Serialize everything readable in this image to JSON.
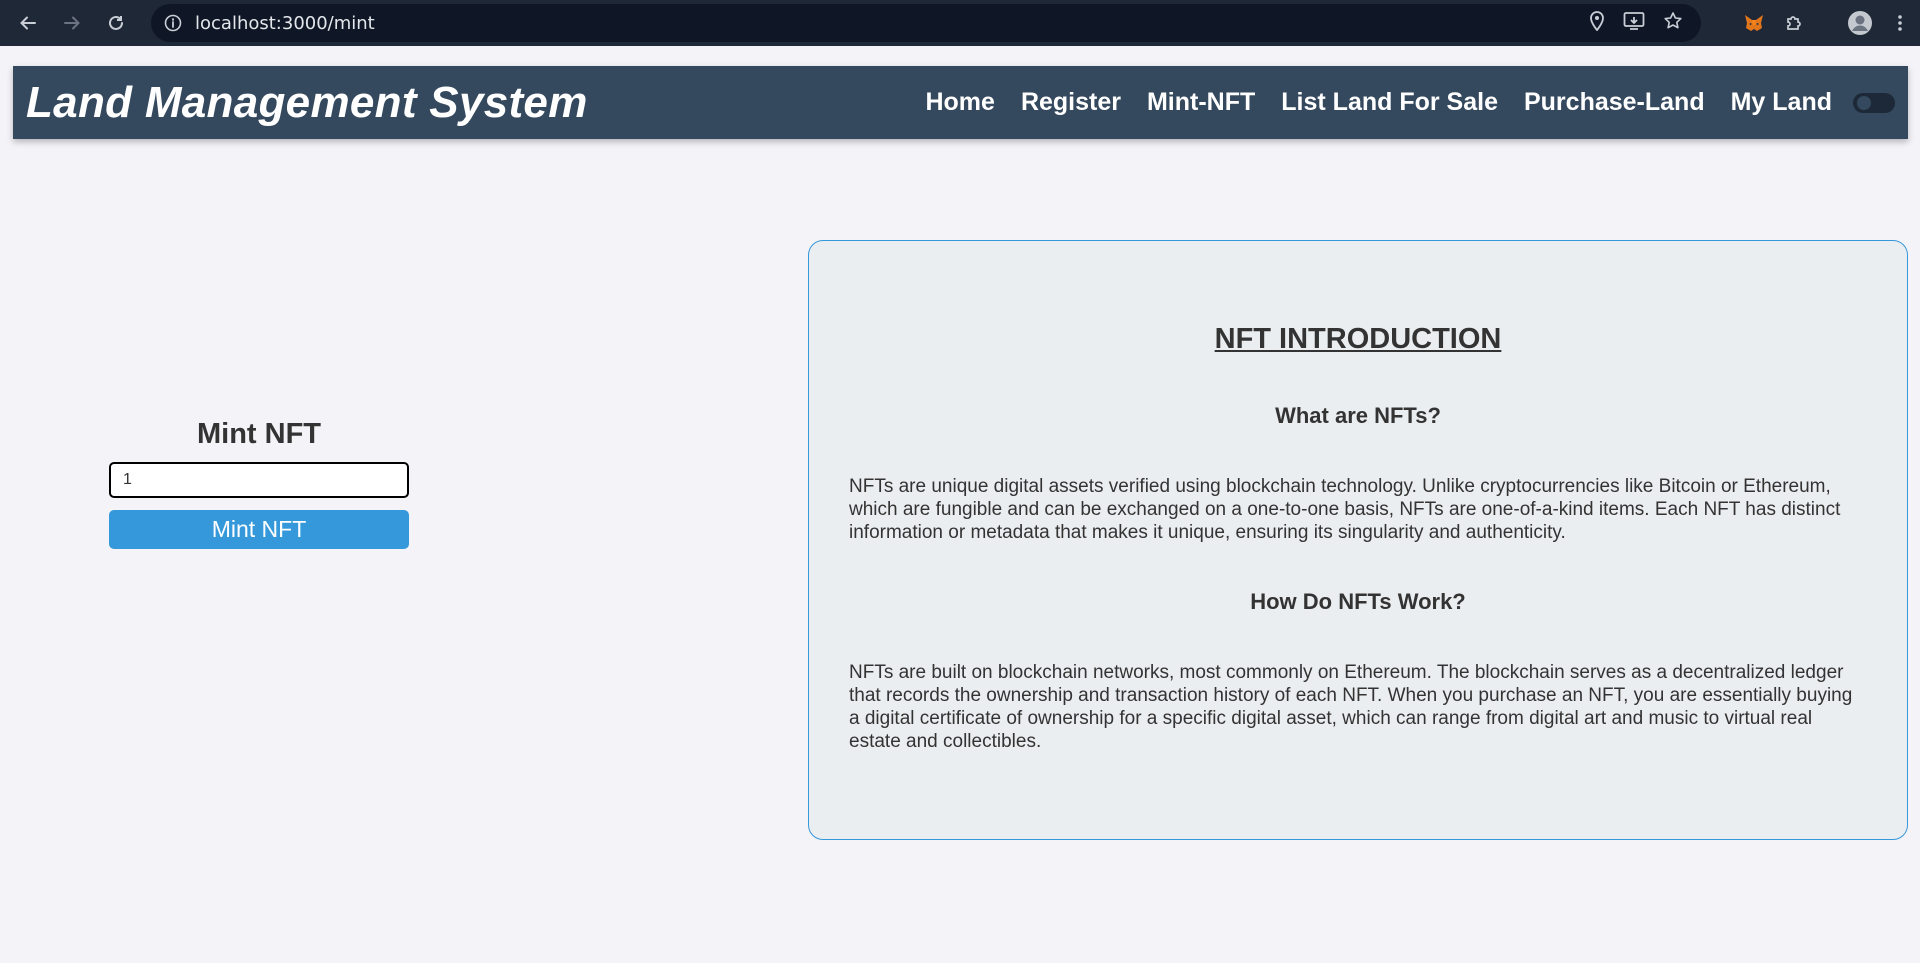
{
  "browser": {
    "url": "localhost:3000/mint"
  },
  "header": {
    "brand": "Land Management System",
    "menu": [
      "Home",
      "Register",
      "Mint-NFT",
      "List Land For Sale",
      "Purchase-Land",
      "My Land"
    ]
  },
  "mint": {
    "title": "Mint NFT",
    "input_value": "1",
    "button_label": "Mint NFT"
  },
  "intro": {
    "heading": "NFT INTRODUCTION",
    "q1": "What are NFTs?",
    "p1": "NFTs are unique digital assets verified using blockchain technology. Unlike cryptocurrencies like Bitcoin or Ethereum, which are fungible and can be exchanged on a one-to-one basis, NFTs are one-of-a-kind items. Each NFT has distinct information or metadata that makes it unique, ensuring its singularity and authenticity.",
    "q2": "How Do NFTs Work?",
    "p2": "NFTs are built on blockchain networks, most commonly on Ethereum. The blockchain serves as a decentralized ledger that records the ownership and transaction history of each NFT. When you purchase an NFT, you are essentially buying a digital certificate of ownership for a specific digital asset, which can range from digital art and music to virtual real estate and collectibles."
  },
  "colors": {
    "header_bg": "#34495e",
    "accent": "#3498db",
    "card_bg": "#ebeef0",
    "page_bg": "#f3f3f8"
  }
}
